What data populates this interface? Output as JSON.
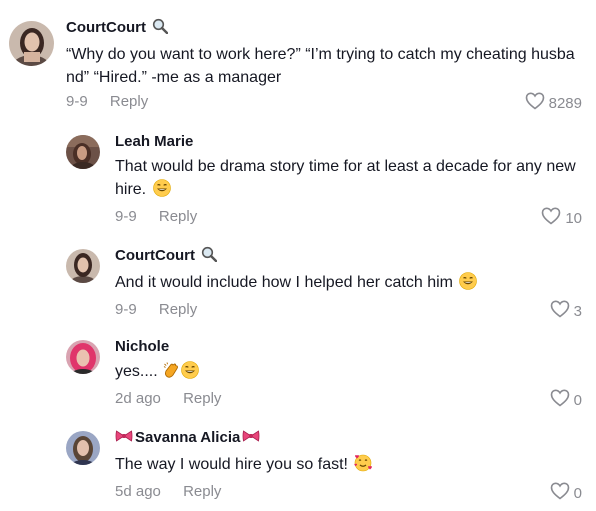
{
  "comments": [
    {
      "username": "CourtCourt",
      "name_badge": "magnifier-icon",
      "text": "“Why do you want to work here?” “I’m trying to catch my cheating husband” “Hired.” -me as a manager",
      "date": "9-9",
      "reply_label": "Reply",
      "likes": "8289"
    },
    {
      "username": "Leah Marie",
      "text": "That would be drama story time for at least a decade for any new hire.",
      "emoji": "laughing-emoji",
      "date": "9-9",
      "reply_label": "Reply",
      "likes": "10"
    },
    {
      "username": "CourtCourt",
      "name_badge": "magnifier-icon",
      "text": "And it would include how I helped her catch him",
      "emoji": "laughing-emoji",
      "date": "9-9",
      "reply_label": "Reply",
      "likes": "3"
    },
    {
      "username": "Nichole",
      "text": "yes....",
      "emojis": [
        "clapping-hand-emoji",
        "laughing-emoji"
      ],
      "date": "2d ago",
      "reply_label": "Reply",
      "likes": "0"
    },
    {
      "username": "Savanna Alicia",
      "name_badges": [
        "ribbon-icon",
        "ribbon-icon"
      ],
      "text": "The way I would hire you so fast!",
      "emoji": "smiling-hearts-emoji",
      "date": "5d ago",
      "reply_label": "Reply",
      "likes": "0"
    }
  ],
  "colors": {
    "text": "#161823",
    "meta": "#8a8b91",
    "ribbon": "#e8457a"
  }
}
